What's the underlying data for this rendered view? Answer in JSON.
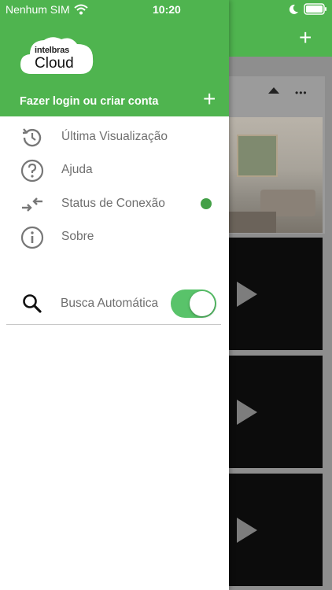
{
  "status_bar": {
    "carrier": "Nenhum SIM",
    "time": "10:20"
  },
  "background": {
    "add_label": "+",
    "more_label": "•••"
  },
  "drawer": {
    "logo": {
      "brand": "intelbras",
      "name": "Cloud"
    },
    "login_label": "Fazer login ou criar conta",
    "add_label": "+",
    "menu": [
      {
        "label": "Última Visualização",
        "icon": "history-icon"
      },
      {
        "label": "Ajuda",
        "icon": "help-icon"
      },
      {
        "label": "Status de Conexão",
        "icon": "connection-arrows-icon"
      },
      {
        "label": "Sobre",
        "icon": "info-icon"
      }
    ],
    "auto_search": {
      "label": "Busca Automática",
      "enabled": true
    }
  },
  "colors": {
    "brand_green": "#4fb44f",
    "toggle_on": "#59c36a",
    "status_online": "#43a047"
  }
}
